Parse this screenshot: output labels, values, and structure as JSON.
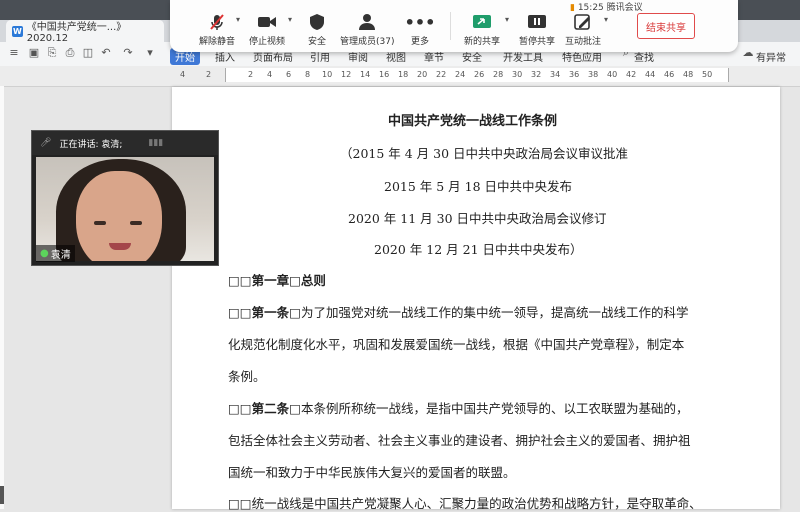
{
  "meeting_bar": {
    "time": "15:25",
    "app": "腾讯会议",
    "buttons": [
      {
        "label": "解除静音",
        "icon": "mic-muted-icon"
      },
      {
        "label": "停止视频",
        "icon": "video-camera-icon"
      },
      {
        "label": "安全",
        "icon": "shield-icon"
      },
      {
        "label": "管理成员(37)",
        "icon": "members-icon"
      },
      {
        "label": "更多",
        "icon": "more-icon"
      },
      {
        "label": "新的共享",
        "icon": "share-screen-icon"
      },
      {
        "label": "暂停共享",
        "icon": "pause-share-icon"
      },
      {
        "label": "互动批注",
        "icon": "annotate-icon"
      }
    ],
    "end_share": "结束共享"
  },
  "document_tab": {
    "title": "《中国共产党统一...》2020.12"
  },
  "ribbon": {
    "tabs": [
      "开始",
      "插入",
      "页面布局",
      "引用",
      "审阅",
      "视图",
      "章节",
      "安全",
      "开发工具",
      "特色应用"
    ],
    "search": "查找",
    "status": "有异常"
  },
  "ruler": {
    "ticks": [
      "4",
      "2",
      "2",
      "4",
      "6",
      "8",
      "10",
      "12",
      "14",
      "16",
      "18",
      "20",
      "22",
      "24",
      "26",
      "28",
      "30",
      "32",
      "34",
      "36",
      "38",
      "40",
      "42",
      "44",
      "46",
      "48",
      "50"
    ]
  },
  "video_panel": {
    "speaking": "正在讲话: 袁清;",
    "name": "袁清"
  },
  "document": {
    "title": "中国共产党统一战线工作条例",
    "meta": [
      "（2015 年 4 月 30 日中共中央政治局会议审议批准",
      "2015 年 5 月 18 日中共中央发布",
      "2020 年 11 月 30 日中共中央政治局会议修订",
      "2020 年 12 月 21 日中共中央发布）"
    ],
    "chapter": {
      "prefix": "□□",
      "text": "第一章□总则"
    },
    "article1": {
      "prefix": "□□",
      "head": "第一条",
      "line1": "□为了加强党对统一战线工作的集中统一领导，提高统一战线工作的科学",
      "line2": "化规范化制度化水平，巩固和发展爱国统一战线，根据《中国共产党章程》，制定本",
      "line3": "条例。"
    },
    "article2": {
      "prefix": "□□",
      "head": "第二条",
      "line1": "□本条例所称统一战线，是指中国共产党领导的、以工农联盟为基础的，",
      "line2": "包括全体社会主义劳动者、社会主义事业的建设者、拥护社会主义的爱国者、拥护祖",
      "line3": "国统一和致力于中华民族伟大复兴的爱国者的联盟。"
    },
    "para3": {
      "prefix": "□□",
      "line1": "统一战线是中国共产党凝聚人心、汇聚力量的政治优势和战略方针，是夺取革命、"
    }
  }
}
